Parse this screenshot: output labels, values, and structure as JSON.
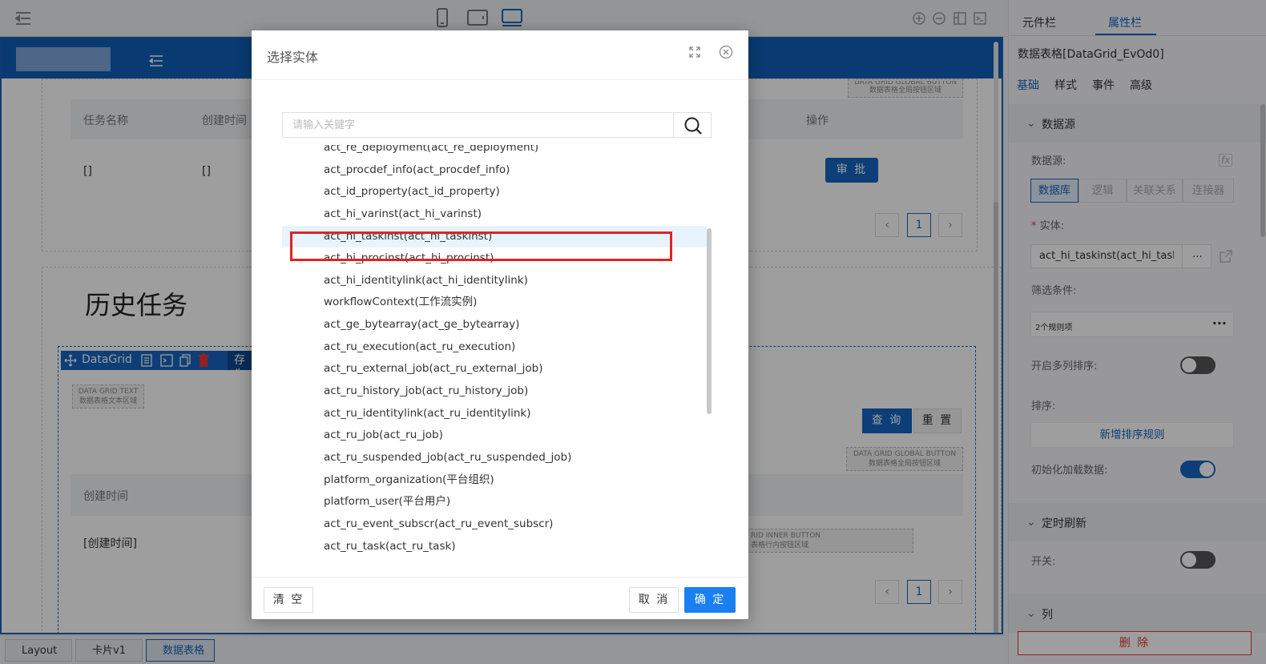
{
  "canvas": {
    "table1": {
      "headers": [
        "任务名称",
        "创建时间",
        "操作"
      ],
      "cells": [
        "[]",
        "[]"
      ],
      "approve": "审 批",
      "page": "1",
      "tag_top": "DATA GRID GLOBAL BUTTON",
      "tag_bottom": "数据表格全局按钮区域"
    },
    "history_title": "历史任务",
    "datagrid": {
      "label": "DataGrid",
      "saveas": "存为"
    },
    "text_tag": [
      "DATA GRID TEXT",
      "数据表格文本区域"
    ],
    "global_tag": [
      "DATA GRID GLOBAL BUTTON",
      "数据表格全局按钮区域"
    ],
    "inner_tag": [
      "RID INNER BUTTON",
      "表格行内按钮区域"
    ],
    "query": "查 询",
    "reset": "重 置",
    "table2": {
      "header": "创建时间",
      "cell": "[创建时间]",
      "page": "1"
    }
  },
  "breadcrumb": [
    "Layout",
    "卡片v1",
    "数据表格"
  ],
  "panel": {
    "tabs": [
      "元件栏",
      "属性栏"
    ],
    "title": "数据表格[DataGrid_EvOd0]",
    "subtabs": [
      "基础",
      "样式",
      "事件",
      "高级"
    ],
    "datasource_section": "数据源",
    "datasource_label": "数据源:",
    "source_tabs": [
      "数据库",
      "逻辑",
      "关联关系",
      "连接器"
    ],
    "entity_label": "实体:",
    "entity_value": "act_hi_taskinst(act_hi_taskin",
    "entity_more": "...",
    "filter_label": "筛选条件:",
    "filter_value": "2个规则项",
    "multisort_label": "开启多列排序:",
    "sort_label": "排序:",
    "add_sort": "新增排序规则",
    "init_load_label": "初始化加载数据:",
    "timer_section": "定时刷新",
    "switch_label": "开关:",
    "columns_section": "列",
    "delete": "删 除",
    "fx": "fx"
  },
  "modal": {
    "title": "选择实体",
    "search_placeholder": "请输入关键字",
    "items": [
      "act_re_deployment(act_re_deployment)",
      "act_procdef_info(act_procdef_info)",
      "act_id_property(act_id_property)",
      "act_hi_varinst(act_hi_varinst)",
      "act_hi_taskinst(act_hi_taskinst)",
      "act_hi_procinst(act_hi_procinst)",
      "act_hi_identitylink(act_hi_identitylink)",
      "workflowContext(工作流实例)",
      "act_ge_bytearray(act_ge_bytearray)",
      "act_ru_execution(act_ru_execution)",
      "act_ru_external_job(act_ru_external_job)",
      "act_ru_history_job(act_ru_history_job)",
      "act_ru_identitylink(act_ru_identitylink)",
      "act_ru_job(act_ru_job)",
      "act_ru_suspended_job(act_ru_suspended_job)",
      "platform_organization(平台组织)",
      "platform_user(平台用户)",
      "act_ru_event_subscr(act_ru_event_subscr)",
      "act_ru_task(act_ru_task)"
    ],
    "selected_index": 4,
    "clear": "清 空",
    "cancel": "取 消",
    "ok": "确 定"
  },
  "colors": {
    "primary": "#1565c0",
    "header_blue": "#0f5fb8",
    "highlight": "#e02424",
    "toggle_on": "#1565c0",
    "toggle_off": "#555555"
  }
}
